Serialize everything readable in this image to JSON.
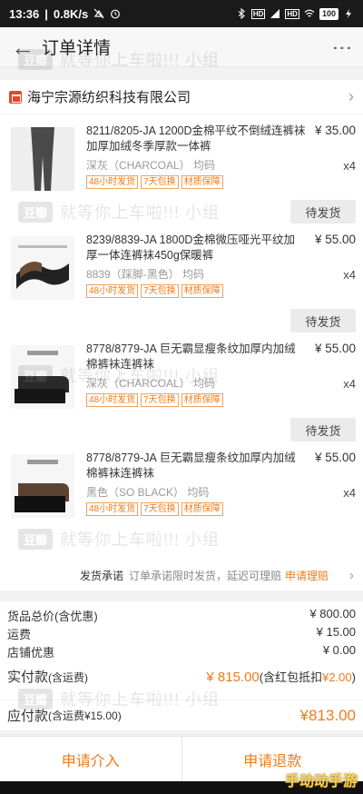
{
  "status_bar": {
    "time": "13:36",
    "speed": "0.8K/s",
    "battery": "100"
  },
  "header": {
    "title": "订单详情"
  },
  "shop": {
    "name": "海宁宗源纺织科技有限公司"
  },
  "items": [
    {
      "title": "8211/8205-JA 1200D金棉平纹不倒绒连裤袜加厚加绒冬季厚款一体裤",
      "price": "¥ 35.00",
      "variant": "深灰（CHARCOAL） 均码",
      "qty": "x4",
      "tags": [
        "48小时发货",
        "7天包换",
        "材质保障"
      ],
      "button": "待发货"
    },
    {
      "title": "8239/8839-JA 1800D金棉微压哑光平纹加厚一体连裤袜450g保暖裤",
      "price": "¥ 55.00",
      "variant": "8839（踩脚-黑色） 均码",
      "qty": "x4",
      "tags": [
        "48小时发货",
        "7天包换",
        "材质保障"
      ],
      "button": "待发货"
    },
    {
      "title": "8778/8779-JA 巨无霸显瘦条纹加厚内加绒棉裤袜连裤袜",
      "price": "¥ 55.00",
      "variant": "深灰（CHARCOAL） 均码",
      "qty": "x4",
      "tags": [
        "48小时发货",
        "7天包换",
        "材质保障"
      ],
      "button": "待发货"
    },
    {
      "title": "8778/8779-JA 巨无霸显瘦条纹加厚内加绒棉裤袜连裤袜",
      "price": "¥ 55.00",
      "variant": "黑色（SO BLACK） 均码",
      "qty": "x4",
      "tags": [
        "48小时发货",
        "7天包换",
        "材质保障"
      ],
      "button": ""
    }
  ],
  "promise": {
    "label": "发货承诺",
    "text": "订单承诺限时发货，延迟可理赔",
    "link": "申请理赔"
  },
  "summary": {
    "goods_label": "货品总价(含优惠)",
    "goods_value": "¥ 800.00",
    "shipping_label": "运费",
    "shipping_value": "¥ 15.00",
    "discount_label": "店铺优惠",
    "discount_value": "¥ 0.00",
    "paid_label": "实付款",
    "paid_note": "(含运费)",
    "paid_value": "¥ 815.00",
    "paid_extra": "(含红包抵扣",
    "paid_extra_value": "¥2.00",
    "paid_extra_close": ")",
    "due_label": "应付款",
    "due_note": "(含运费¥15.00)",
    "due_value": "¥813.00"
  },
  "bottom": {
    "left_button": "申请介入",
    "right_button": "申请退款"
  },
  "watermark": {
    "logo": "豆瓣",
    "text": "就等你上车啦!!! 小组",
    "corner": "手动动手游"
  },
  "colors": {
    "accent": "#f07a18",
    "shop_icon": "#e8452c"
  }
}
